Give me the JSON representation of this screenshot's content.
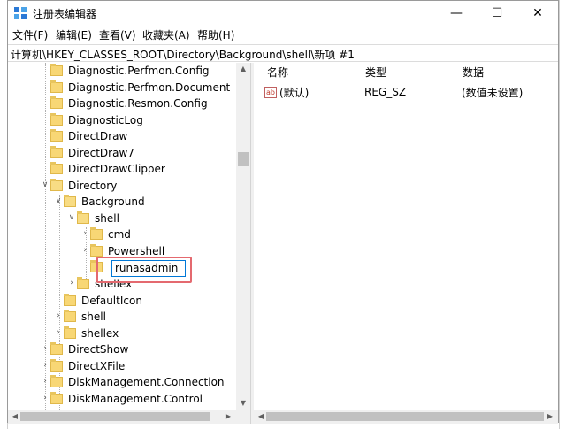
{
  "window": {
    "title": "注册表编辑器",
    "controls": {
      "minimize": "—",
      "maximize": "☐",
      "close": "✕"
    }
  },
  "menu": [
    "文件(F)",
    "编辑(E)",
    "查看(V)",
    "收藏夹(A)",
    "帮助(H)"
  ],
  "address": "计算机\\HKEY_CLASSES_ROOT\\Directory\\Background\\shell\\新项 #1",
  "tree": [
    {
      "label": "Diagnostic.Perfmon.Config"
    },
    {
      "label": "Diagnostic.Perfmon.Document"
    },
    {
      "label": "Diagnostic.Resmon.Config"
    },
    {
      "label": "DiagnosticLog"
    },
    {
      "label": "DirectDraw"
    },
    {
      "label": "DirectDraw7"
    },
    {
      "label": "DirectDrawClipper"
    },
    {
      "label": "Directory"
    },
    {
      "label": "Background"
    },
    {
      "label": "shell"
    },
    {
      "label": "cmd"
    },
    {
      "label": "Powershell"
    },
    {
      "label": "runasadmin"
    },
    {
      "label": "shellex"
    },
    {
      "label": "DefaultIcon"
    },
    {
      "label": "shell"
    },
    {
      "label": "shellex"
    },
    {
      "label": "DirectShow"
    },
    {
      "label": "DirectXFile"
    },
    {
      "label": "DiskManagement.Connection"
    },
    {
      "label": "DiskManagement.Control"
    }
  ],
  "values": {
    "headers": {
      "name": "名称",
      "type": "类型",
      "data": "数据"
    },
    "rows": [
      {
        "icon": "ab",
        "name": "(默认)",
        "type": "REG_SZ",
        "data": "(数值未设置)"
      }
    ]
  },
  "colors": {
    "highlight": "#e4696f",
    "folder": "#f8d775",
    "selection_border": "#0078d7"
  }
}
